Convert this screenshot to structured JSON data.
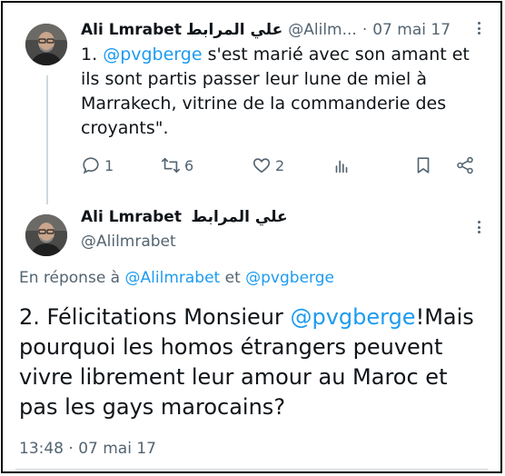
{
  "tweet1": {
    "author_name": "Ali Lmrabet",
    "author_name_arabic": "علي المرابط",
    "handle": "@Alilm...",
    "separator": "·",
    "date": "07 mai 17",
    "text_number": "1.",
    "mention": "@pvgberge",
    "text_rest": " s'est marié avec son amant et ils sont partis passer leur lune de miel à Marrakech, vitrine de la commanderie des croyants\".",
    "actions": {
      "reply_count": "1",
      "retweet_count": "6",
      "like_count": "2"
    }
  },
  "tweet2": {
    "author_name": "Ali Lmrabet",
    "author_name_arabic": "علي المرابط",
    "handle": "@Alilmrabet",
    "reply_prefix": "En réponse à ",
    "reply_mention1": "@Alilmrabet",
    "reply_and": " et ",
    "reply_mention2": "@pvgberge",
    "text_start": "2. Félicitations Monsieur ",
    "mention": "@pvgberge",
    "text_rest": "!Mais pourquoi les homos étrangers peuvent vivre librement leur amour au Maroc et pas les gays marocains?",
    "timestamp": "13:48 · 07 mai 17"
  },
  "icons": {
    "reply": "reply-icon",
    "retweet": "retweet-icon",
    "like": "heart-icon",
    "views": "bar-chart-icon",
    "bookmark": "bookmark-icon",
    "share": "share-icon",
    "more": "more-icon"
  },
  "colors": {
    "accent": "#1d9bf0",
    "muted": "#536471",
    "text": "#0f1419"
  }
}
